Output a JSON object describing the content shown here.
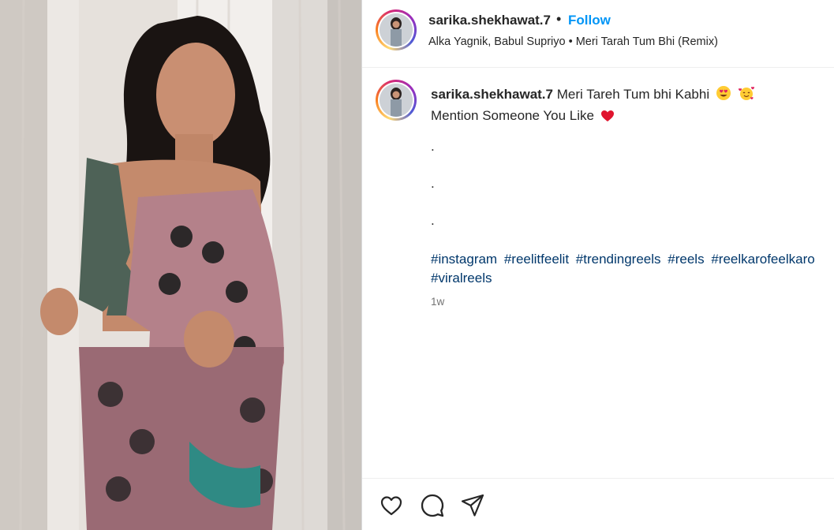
{
  "post": {
    "username": "sarika.shekhawat.7",
    "separator": "•",
    "follow_label": "Follow",
    "audio": "Alka Yagnik, Babul Supriyo • Meri Tarah Tum Bhi (Remix)",
    "caption": {
      "username": "sarika.shekhawat.7",
      "line1": "Meri Tareh Tum bhi Kabhi",
      "line2": "Mention Someone You Like",
      "dots": [
        ".",
        ".",
        "."
      ],
      "hashtags": [
        "#instagram",
        "#reelitfeelit",
        "#trendingreels",
        "#reels",
        "#reelkarofeelkaro",
        "#viralreels"
      ]
    },
    "timestamp": "1w"
  },
  "icons": {
    "like": "heart-icon",
    "comment": "comment-icon",
    "share": "share-icon",
    "emoji_1": "heart-eyes-emoji",
    "emoji_2": "hearts-face-emoji",
    "emoji_3": "red-heart-emoji"
  },
  "colors": {
    "follow": "#0095f6",
    "hashtag": "#00376b",
    "timestamp": "#737373",
    "text": "#262626"
  }
}
